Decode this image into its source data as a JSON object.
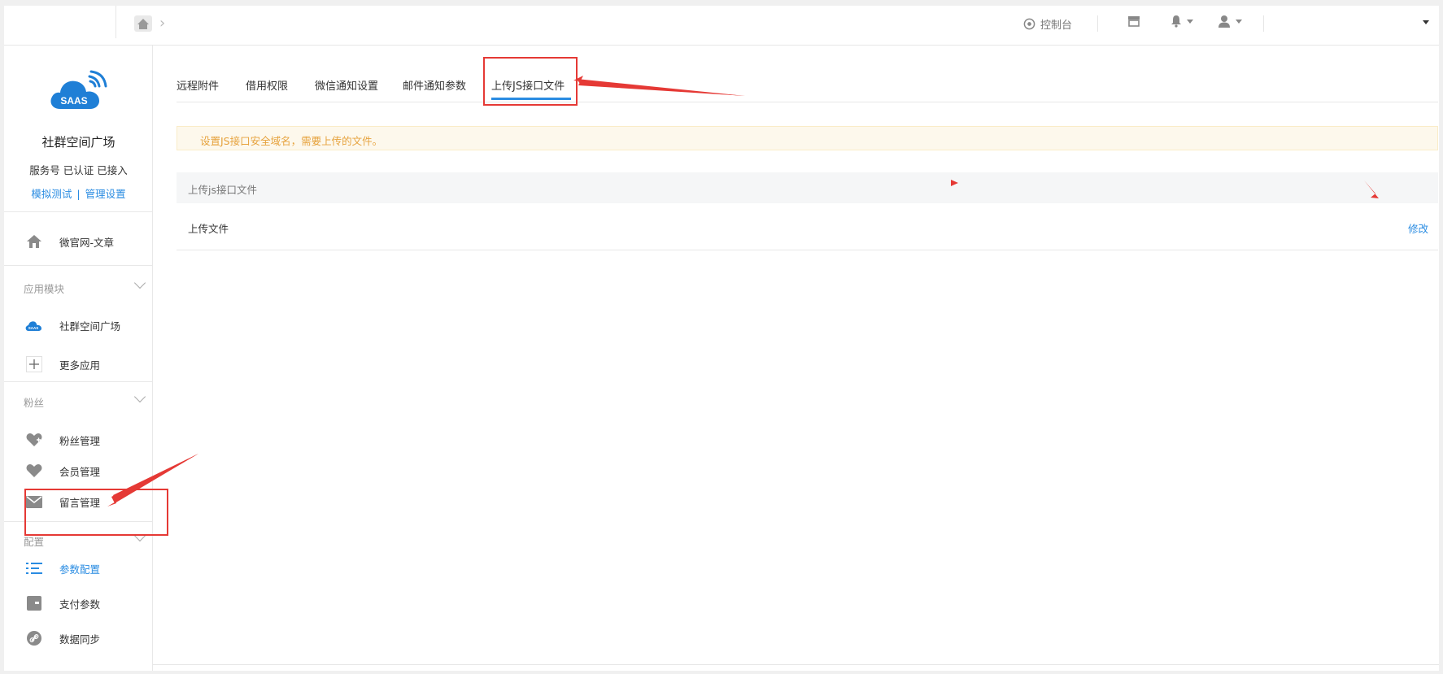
{
  "topbar": {
    "console_label": "控制台"
  },
  "sidebar": {
    "logo_text": "SAAS",
    "account_name": "社群空间广场",
    "account_status": "服务号 已认证 已接入",
    "link_test": "模拟测试",
    "link_sep": "|",
    "link_manage": "管理设置",
    "home_item": "微官网-文章",
    "groups": [
      {
        "label": "应用模块",
        "items": [
          "社群空间广场",
          "更多应用"
        ]
      },
      {
        "label": "粉丝",
        "items": [
          "粉丝管理",
          "会员管理",
          "留言管理"
        ]
      },
      {
        "label": "配置",
        "items": [
          "参数配置",
          "支付参数",
          "数据同步"
        ]
      }
    ]
  },
  "main": {
    "tabs": [
      "远程附件",
      "借用权限",
      "微信通知设置",
      "邮件通知参数",
      "上传JS接口文件"
    ],
    "active_tab": "上传JS接口文件",
    "alert": "设置JS接口安全域名，需要上传的文件。",
    "panel_title": "上传js接口文件",
    "row_label": "上传文件",
    "row_action": "修改"
  },
  "colors": {
    "accent": "#2a8ce2",
    "annotation": "#e53935",
    "alert_text": "#e6a23c"
  }
}
